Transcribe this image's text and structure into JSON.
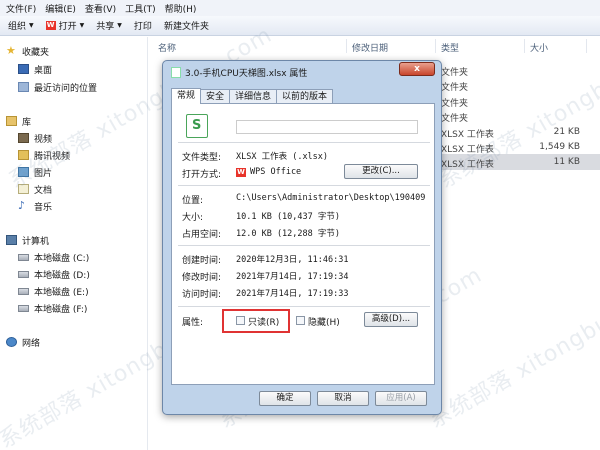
{
  "menubar": {
    "items": [
      "文件(F)",
      "编辑(E)",
      "查看(V)",
      "工具(T)",
      "帮助(H)"
    ]
  },
  "toolbar": {
    "organize": "组织",
    "open": "打开",
    "share": "共享",
    "print": "打印",
    "new_folder": "新建文件夹"
  },
  "sidebar": {
    "favorites": "收藏夹",
    "desktop": "桌面",
    "recent": "最近访问的位置",
    "libraries": "库",
    "video": "视频",
    "tencent_video": "腾讯视频",
    "pictures": "图片",
    "documents": "文档",
    "music": "音乐",
    "computer": "计算机",
    "drive_c": "本地磁盘 (C:)",
    "drive_d": "本地磁盘 (D:)",
    "drive_e": "本地磁盘 (E:)",
    "drive_f": "本地磁盘 (F:)",
    "network": "网络"
  },
  "filelist": {
    "headers": {
      "name": "名称",
      "modified": "修改日期",
      "type": "类型",
      "size": "大小"
    },
    "rows": [
      {
        "type": "文件夹",
        "size": ""
      },
      {
        "type": "文件夹",
        "size": ""
      },
      {
        "type": "文件夹",
        "size": ""
      },
      {
        "type": "文件夹",
        "size": ""
      },
      {
        "type": "XLSX 工作表",
        "size": "21 KB"
      },
      {
        "type": "XLSX 工作表",
        "size": "1,549 KB"
      },
      {
        "type": "XLSX 工作表",
        "size": "11 KB"
      }
    ]
  },
  "watermark": "系统部落 xitongbuluo.com",
  "dialog": {
    "title": "3.0-手机CPU天梯图.xlsx 属性",
    "close": "x",
    "tabs": [
      "常规",
      "安全",
      "详细信息",
      "以前的版本"
    ],
    "file_type_label": "文件类型:",
    "file_type_value": "XLSX 工作表 (.xlsx)",
    "open_with_label": "打开方式:",
    "open_with_value": "WPS Office",
    "change_button": "更改(C)...",
    "location_label": "位置:",
    "location_value": "C:\\Users\\Administrator\\Desktop\\190409",
    "size_label": "大小:",
    "size_value": "10.1 KB (10,437 字节)",
    "disk_size_label": "占用空间:",
    "disk_size_value": "12.0 KB (12,288 字节)",
    "created_label": "创建时间:",
    "created_value": "2020年12月3日, 11:46:31",
    "modified_label": "修改时间:",
    "modified_value": "2021年7月14日, 17:19:34",
    "accessed_label": "访问时间:",
    "accessed_value": "2021年7月14日, 17:19:33",
    "attributes_label": "属性:",
    "readonly_label": "只读(R)",
    "hidden_label": "隐藏(H)",
    "advanced_button": "高级(D)...",
    "ok_button": "确定",
    "cancel_button": "取消",
    "apply_button": "应用(A)"
  }
}
